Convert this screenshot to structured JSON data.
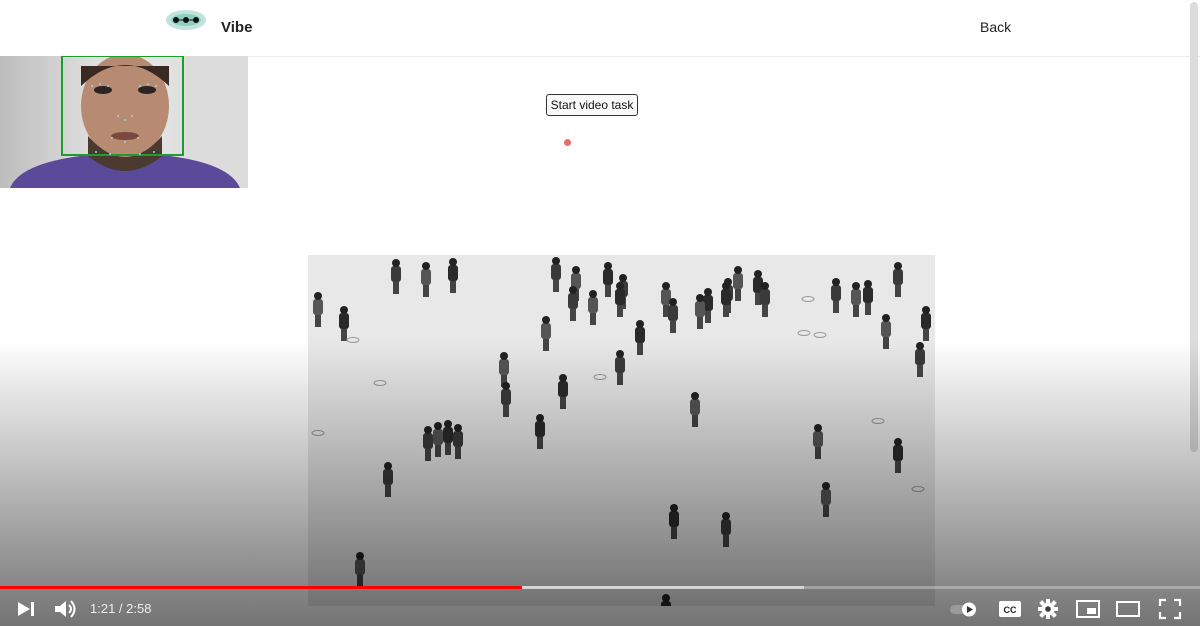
{
  "header": {
    "brand": "Vibe",
    "back_label": "Back"
  },
  "task": {
    "start_label": "Start video task"
  },
  "player": {
    "time_display": "1:21 / 2:58",
    "played_fraction": 0.435,
    "buffered_fraction": 0.67,
    "played_color": "#ff0000",
    "cc_label": "CC"
  },
  "icons": {
    "logo": "logo-eye-icon",
    "play": "next-play-icon",
    "volume": "volume-icon",
    "autoplay": "autoplay-toggle-icon",
    "settings": "gear-icon",
    "miniplayer": "miniplayer-icon",
    "theater": "theater-mode-icon",
    "fullscreen": "fullscreen-icon"
  }
}
